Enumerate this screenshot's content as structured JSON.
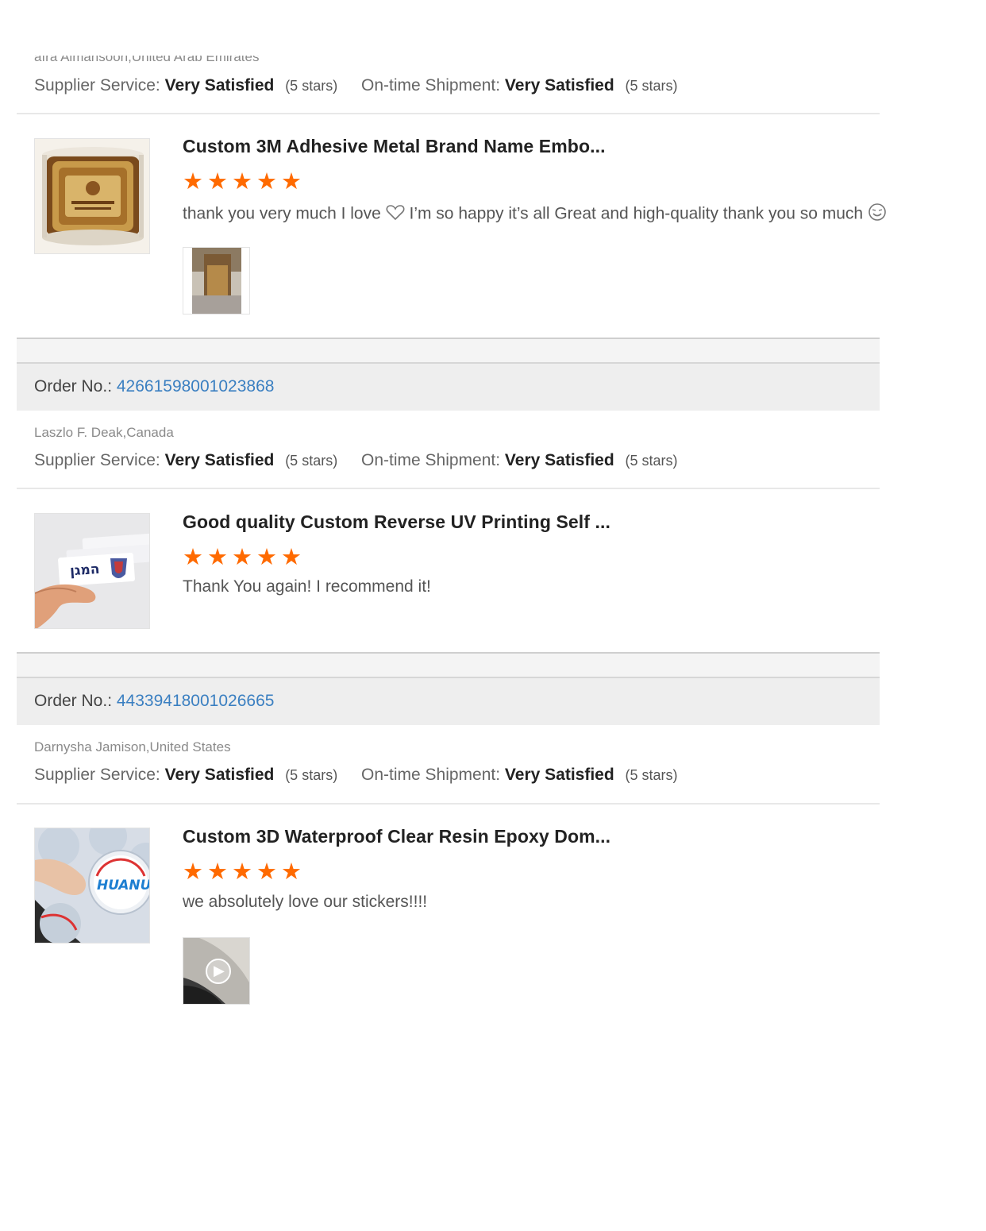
{
  "reviews": [
    {
      "reviewer": "afra Almansoori,United Arab Emirates",
      "supplier_label": "Supplier Service:",
      "supplier_value": "Very Satisfied",
      "supplier_stars": "(5 stars)",
      "shipment_label": "On-time Shipment:",
      "shipment_value": "Very Satisfied",
      "shipment_stars": "(5 stars)",
      "product_title": "Custom 3M Adhesive Metal Brand Name Embo...",
      "rating": 5,
      "comment_part1": "thank you very much I love",
      "comment_part2": "I’m so happy it’s all  Great  and high-quality thank you so much",
      "product_image": "gold-metal-label-roll",
      "photo": "bottle-photo"
    },
    {
      "order_label": "Order No.:",
      "order_number": "42661598001023868",
      "reviewer": "Laszlo F. Deak,Canada",
      "supplier_label": "Supplier Service:",
      "supplier_value": "Very Satisfied",
      "supplier_stars": "(5 stars)",
      "shipment_label": "On-time Shipment:",
      "shipment_value": "Very Satisfied",
      "shipment_stars": "(5 stars)",
      "product_title": "Good quality Custom Reverse UV Printing Self ...",
      "rating": 5,
      "comment": "Thank You again! I recommend it!",
      "product_image": "reverse-uv-sticker-hand"
    },
    {
      "order_label": "Order No.:",
      "order_number": "44339418001026665",
      "reviewer": "Darnysha Jamison,United States",
      "supplier_label": "Supplier Service:",
      "supplier_value": "Very Satisfied",
      "supplier_stars": "(5 stars)",
      "shipment_label": "On-time Shipment:",
      "shipment_value": "Very Satisfied",
      "shipment_stars": "(5 stars)",
      "product_title": "Custom 3D Waterproof Clear Resin Epoxy Dom...",
      "rating": 5,
      "comment": "we absolutely love our stickers!!!!",
      "product_image": "epoxy-dome-stickers",
      "product_image_text": "HUANUO",
      "photo": "video-thumbnail"
    }
  ],
  "colors": {
    "star": "#ff6a00",
    "link": "#3a7fc1",
    "band": "#eeeeee"
  }
}
